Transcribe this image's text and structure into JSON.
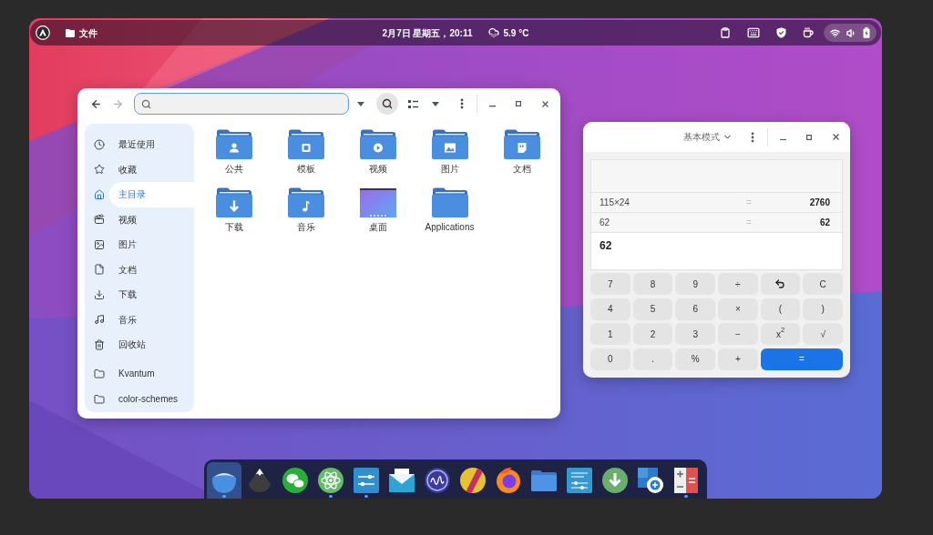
{
  "top_bar": {
    "app_menu": {
      "label": "文件"
    },
    "clock": "2月7日 星期五，20:11",
    "weather": {
      "temperature": "5.9 °C"
    }
  },
  "file_manager": {
    "navigation": {
      "back": {
        "disabled": false
      },
      "forward": {
        "disabled": true
      }
    },
    "search": {
      "focused": true
    },
    "search_toggle": {
      "on": true
    },
    "sidebar": {
      "places": [
        {
          "label": "最近使用",
          "kind": "recent",
          "selected": false
        },
        {
          "label": "收藏",
          "kind": "starred",
          "selected": false
        },
        {
          "label": "主目录",
          "kind": "home",
          "selected": true
        },
        {
          "label": "视频",
          "kind": "videos",
          "selected": false
        },
        {
          "label": "图片",
          "kind": "pictures",
          "selected": false
        },
        {
          "label": "文档",
          "kind": "documents",
          "selected": false
        },
        {
          "label": "下载",
          "kind": "downloads",
          "selected": false
        },
        {
          "label": "音乐",
          "kind": "music",
          "selected": false
        },
        {
          "label": "回收站",
          "kind": "trash",
          "selected": false
        }
      ],
      "bookmarks": [
        {
          "label": "Kvantum",
          "selected": false
        },
        {
          "label": "color-schemes",
          "selected": false
        }
      ]
    },
    "files": [
      {
        "name": "公共",
        "kind": "public"
      },
      {
        "name": "模板",
        "kind": "templates"
      },
      {
        "name": "视频",
        "kind": "videos"
      },
      {
        "name": "图片",
        "kind": "pictures"
      },
      {
        "name": "文档",
        "kind": "documents"
      },
      {
        "name": "下载",
        "kind": "downloads"
      },
      {
        "name": "音乐",
        "kind": "music"
      },
      {
        "name": "桌面",
        "kind": "desktop"
      },
      {
        "name": "Applications",
        "kind": "folder"
      }
    ]
  },
  "calculator": {
    "mode": "基本模式",
    "history": [
      {
        "expression": "115×24",
        "equals": "=",
        "result": "2760"
      },
      {
        "expression": "62",
        "equals": "=",
        "result": "62"
      }
    ],
    "entry": "62",
    "keys": [
      {
        "kind": "key",
        "label": "7"
      },
      {
        "kind": "key",
        "label": "8"
      },
      {
        "kind": "key",
        "label": "9"
      },
      {
        "kind": "key",
        "label": "÷"
      },
      {
        "kind": "undo"
      },
      {
        "kind": "key",
        "label": "C"
      },
      {
        "kind": "key",
        "label": "4"
      },
      {
        "kind": "key",
        "label": "5"
      },
      {
        "kind": "key",
        "label": "6"
      },
      {
        "kind": "key",
        "label": "×"
      },
      {
        "kind": "key",
        "label": "("
      },
      {
        "kind": "key",
        "label": ")"
      },
      {
        "kind": "key",
        "label": "1"
      },
      {
        "kind": "key",
        "label": "2"
      },
      {
        "kind": "key",
        "label": "3"
      },
      {
        "kind": "key",
        "label": "−"
      },
      {
        "kind": "key",
        "label": "x$^{2}$"
      },
      {
        "kind": "key",
        "label": "√"
      },
      {
        "kind": "key",
        "label": "0"
      },
      {
        "kind": "key",
        "label": "."
      },
      {
        "kind": "key",
        "label": "%"
      },
      {
        "kind": "key",
        "label": "+"
      },
      {
        "kind": "equals",
        "label": "="
      }
    ]
  },
  "dock": {
    "items": [
      {
        "kind": "bowl",
        "selected": true,
        "running": true
      },
      {
        "kind": "mountain",
        "selected": false,
        "running": false
      },
      {
        "kind": "chat",
        "selected": false,
        "running": false
      },
      {
        "kind": "atom",
        "selected": false,
        "running": true
      },
      {
        "kind": "sliders",
        "selected": false,
        "running": true
      },
      {
        "kind": "envelope",
        "selected": false,
        "running": false
      },
      {
        "kind": "wave",
        "selected": false,
        "running": false
      },
      {
        "kind": "ball",
        "selected": false,
        "running": false
      },
      {
        "kind": "flame",
        "selected": false,
        "running": false
      },
      {
        "kind": "folder",
        "selected": false,
        "running": false
      },
      {
        "kind": "panel",
        "selected": false,
        "running": false
      },
      {
        "kind": "download",
        "selected": false,
        "running": false
      },
      {
        "kind": "tiles",
        "selected": false,
        "running": false
      },
      {
        "kind": "calculator",
        "selected": false,
        "running": true
      }
    ]
  }
}
